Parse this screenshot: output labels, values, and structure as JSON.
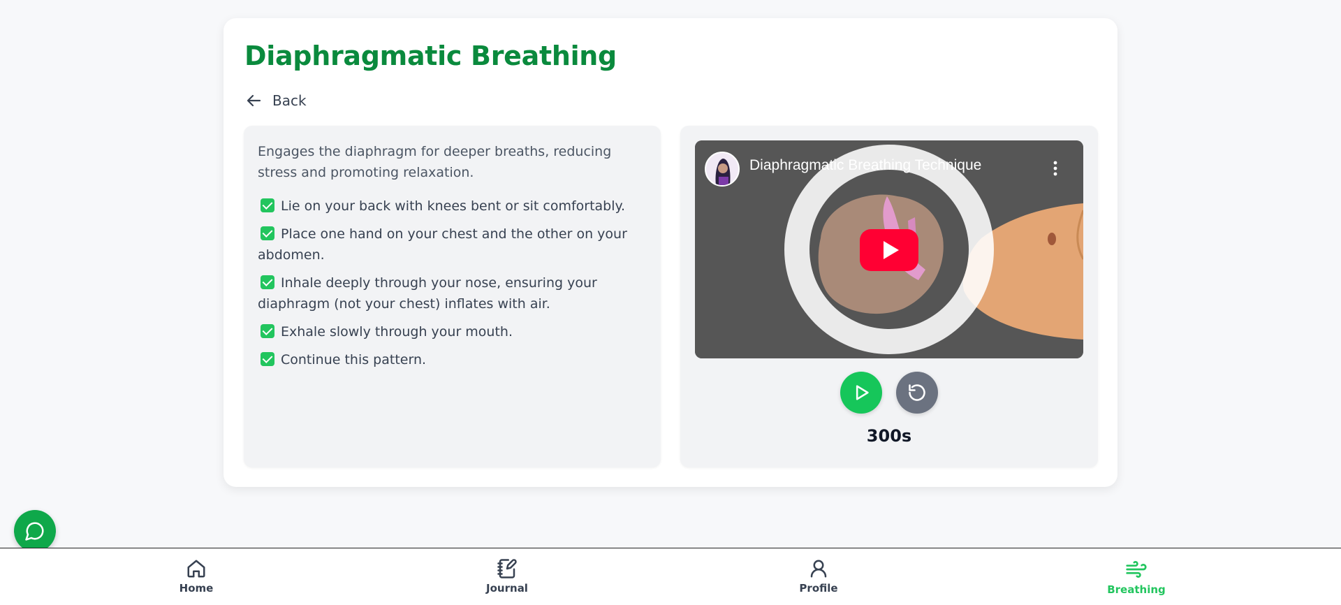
{
  "page": {
    "title": "Diaphragmatic Breathing",
    "back_label": "Back"
  },
  "exercise": {
    "description": "Engages the diaphragm for deeper breaths, reducing stress and promoting relaxation.",
    "steps": [
      "Lie on your back with knees bent or sit comfortably.",
      "Place one hand on your chest and the other on your abdomen.",
      "Inhale deeply through your nose, ensuring your diaphragm (not your chest) inflates with air.",
      "Exhale slowly through your mouth.",
      "Continue this pattern."
    ]
  },
  "video": {
    "title": "Diaphragmatic Breathing Technique"
  },
  "timer": {
    "display": "300s"
  },
  "nav": {
    "items": [
      {
        "label": "Home",
        "icon": "home-icon"
      },
      {
        "label": "Journal",
        "icon": "journal-icon"
      },
      {
        "label": "Profile",
        "icon": "profile-icon"
      },
      {
        "label": "Breathing",
        "icon": "breathing-icon",
        "active": true
      }
    ]
  },
  "colors": {
    "accent": "#0a8a3d",
    "active_nav": "#22c55e",
    "play_button": "#16c65a",
    "reset_button": "#6b7280",
    "youtube_red": "#ff0033"
  }
}
